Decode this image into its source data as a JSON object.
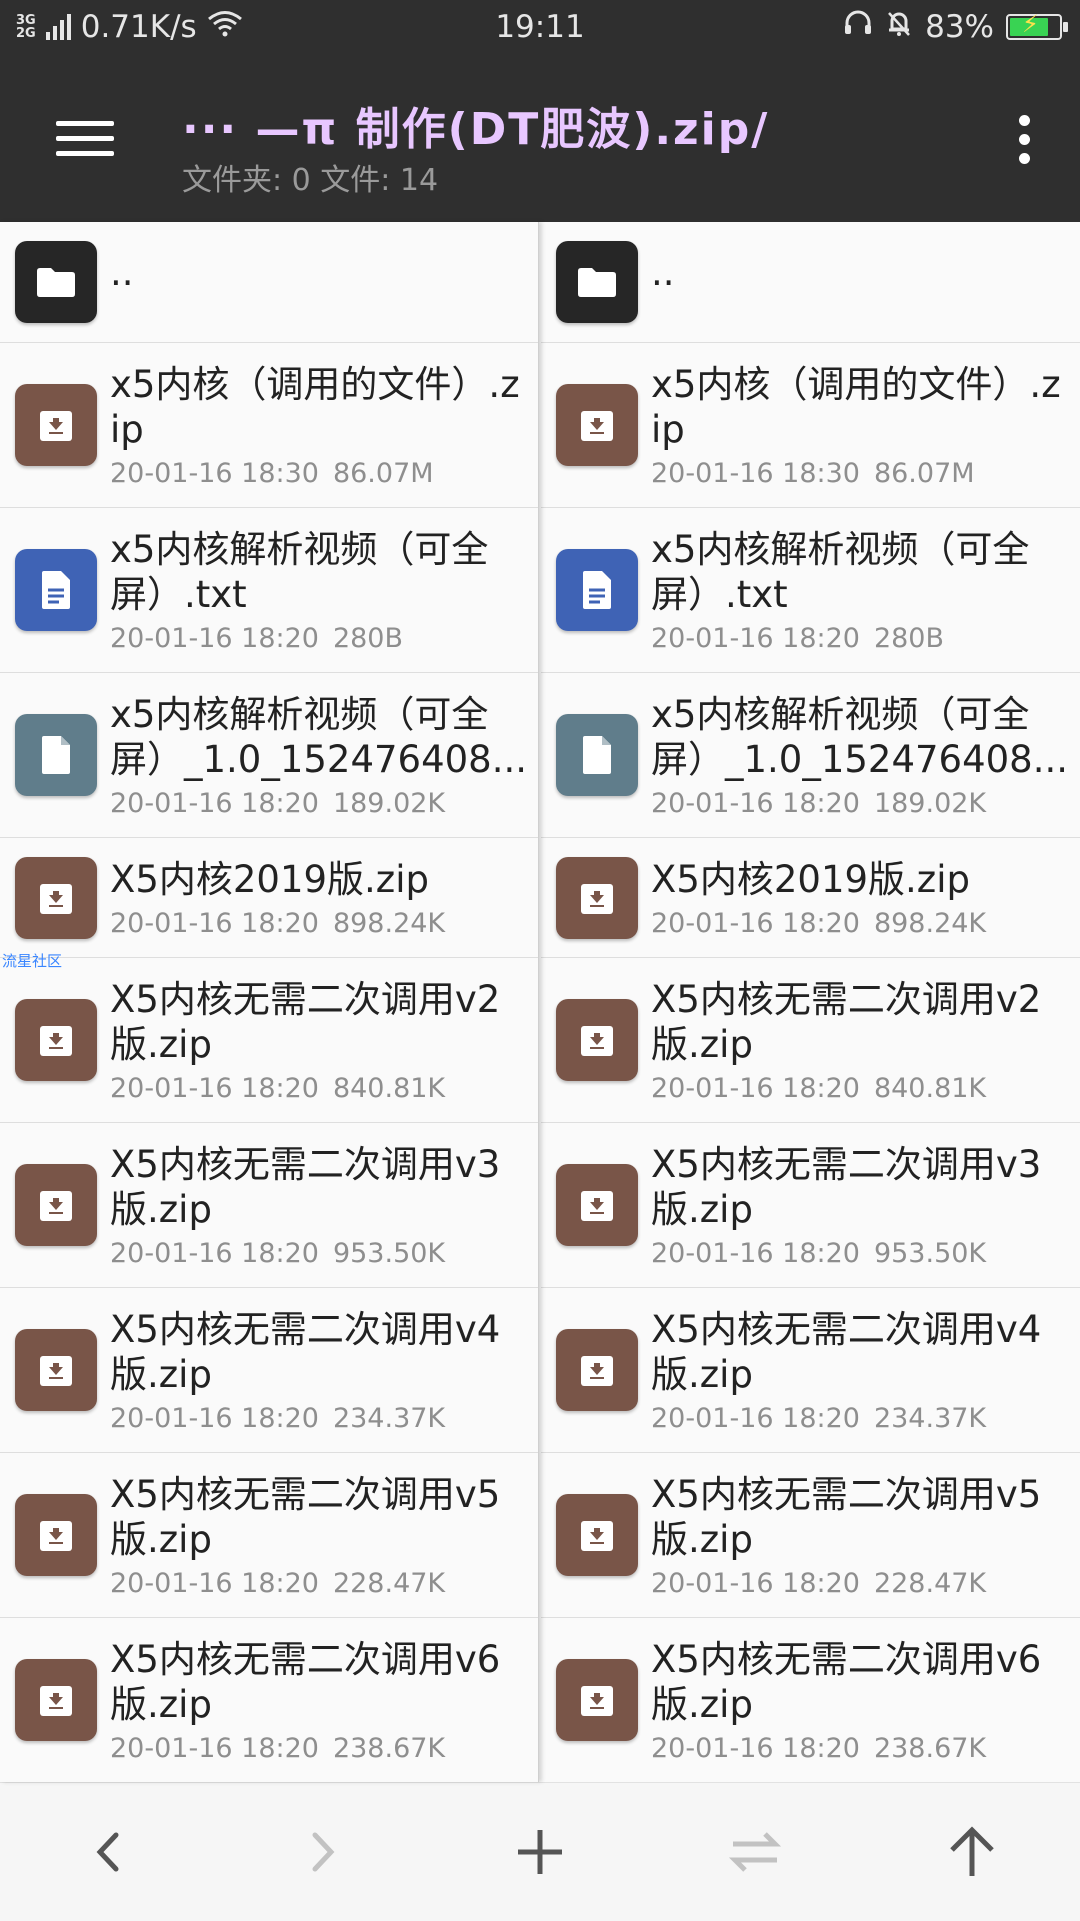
{
  "status_bar": {
    "network_top": "3G",
    "network_bottom": "2G",
    "speed": "0.71K/s",
    "time": "19:11",
    "battery": "83%",
    "battery_level": 0.83
  },
  "app_bar": {
    "path": "··· —π  制作(DT肥波).zip/",
    "subtitle": "文件夹: 0  文件: 14"
  },
  "watermark": "流星社区",
  "colors": {
    "folder": "#262626",
    "archive": "#795548",
    "text": "#3f63b5",
    "file": "#607d8b"
  },
  "left_pane": {
    "parent_label": "..",
    "files": [
      {
        "name": "x5内核（调用的文件）.zip",
        "date": "20-01-16 18:30",
        "size": "86.07M",
        "icon": "archive-icon"
      },
      {
        "name": "x5内核解析视频（可全屏）.txt",
        "date": "20-01-16 18:20",
        "size": "280B",
        "icon": "text-file-icon"
      },
      {
        "name": "x5内核解析视频（可全屏）_1.0_152476408...",
        "date": "20-01-16 18:20",
        "size": "189.02K",
        "icon": "file-icon"
      },
      {
        "name": "X5内核2019版.zip",
        "date": "20-01-16 18:20",
        "size": "898.24K",
        "icon": "archive-icon"
      },
      {
        "name": "X5内核无需二次调用v2版.zip",
        "date": "20-01-16 18:20",
        "size": "840.81K",
        "icon": "archive-icon"
      },
      {
        "name": "X5内核无需二次调用v3版.zip",
        "date": "20-01-16 18:20",
        "size": "953.50K",
        "icon": "archive-icon"
      },
      {
        "name": "X5内核无需二次调用v4版.zip",
        "date": "20-01-16 18:20",
        "size": "234.37K",
        "icon": "archive-icon"
      },
      {
        "name": "X5内核无需二次调用v5版.zip",
        "date": "20-01-16 18:20",
        "size": "228.47K",
        "icon": "archive-icon"
      },
      {
        "name": "X5内核无需二次调用v6版.zip",
        "date": "20-01-16 18:20",
        "size": "238.67K",
        "icon": "archive-icon"
      }
    ]
  },
  "right_pane": {
    "parent_label": "..",
    "files": [
      {
        "name": "x5内核（调用的文件）.zip",
        "date": "20-01-16 18:30",
        "size": "86.07M",
        "icon": "archive-icon"
      },
      {
        "name": "x5内核解析视频（可全屏）.txt",
        "date": "20-01-16 18:20",
        "size": "280B",
        "icon": "text-file-icon"
      },
      {
        "name": "x5内核解析视频（可全屏）_1.0_152476408...",
        "date": "20-01-16 18:20",
        "size": "189.02K",
        "icon": "file-icon"
      },
      {
        "name": "X5内核2019版.zip",
        "date": "20-01-16 18:20",
        "size": "898.24K",
        "icon": "archive-icon"
      },
      {
        "name": "X5内核无需二次调用v2版.zip",
        "date": "20-01-16 18:20",
        "size": "840.81K",
        "icon": "archive-icon"
      },
      {
        "name": "X5内核无需二次调用v3版.zip",
        "date": "20-01-16 18:20",
        "size": "953.50K",
        "icon": "archive-icon"
      },
      {
        "name": "X5内核无需二次调用v4版.zip",
        "date": "20-01-16 18:20",
        "size": "234.37K",
        "icon": "archive-icon"
      },
      {
        "name": "X5内核无需二次调用v5版.zip",
        "date": "20-01-16 18:20",
        "size": "228.47K",
        "icon": "archive-icon"
      },
      {
        "name": "X5内核无需二次调用v6版.zip",
        "date": "20-01-16 18:20",
        "size": "238.67K",
        "icon": "archive-icon"
      }
    ]
  },
  "bottom_nav": [
    {
      "icon": "back-arrow-icon",
      "enabled": true
    },
    {
      "icon": "forward-arrow-icon",
      "enabled": false
    },
    {
      "icon": "add-icon",
      "enabled": true
    },
    {
      "icon": "swap-icon",
      "enabled": false
    },
    {
      "icon": "up-arrow-icon",
      "enabled": true
    }
  ]
}
